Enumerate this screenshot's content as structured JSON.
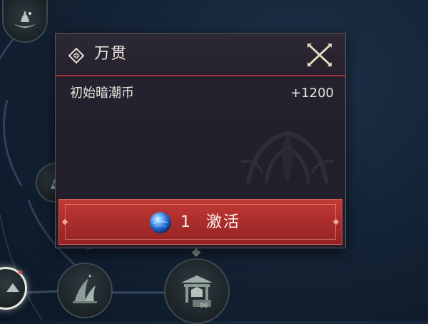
{
  "popup": {
    "title": "万贯",
    "title_icon": "diamond-ornament-icon",
    "close_icon": "crossed-blades-close-icon",
    "rewards": [
      {
        "name": "初始暗潮币",
        "amount": "+1200"
      }
    ],
    "activate": {
      "cost_icon": "blue-orb-icon",
      "cost": "1",
      "label": "激活"
    }
  },
  "skill_tree": {
    "nodes": [
      {
        "icon": "lotus-boat-icon"
      },
      {
        "icon": "partial-node-icon"
      },
      {
        "icon": "selected-node-icon"
      },
      {
        "icon": "blade-tree-icon"
      },
      {
        "icon": "shop-stall-icon",
        "badge": "96"
      }
    ]
  },
  "colors": {
    "accent_red": "#b8322f",
    "header_divider": "#9a3238",
    "panel_bg": "#24212d",
    "background": "#142336"
  }
}
